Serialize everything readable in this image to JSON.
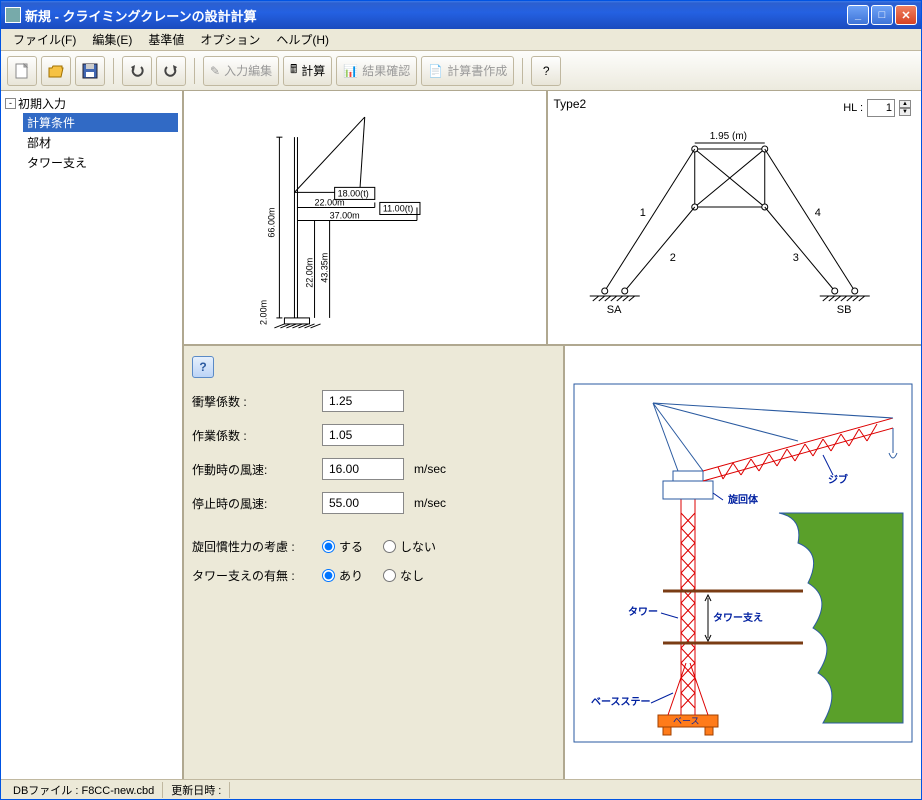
{
  "window": {
    "title": "新規 - クライミングクレーンの設計計算"
  },
  "menu": {
    "file": "ファイル(F)",
    "edit": "編集(E)",
    "base": "基準値",
    "option": "オプション",
    "help": "ヘルプ(H)"
  },
  "toolbar": {
    "input_edit": "入力編集",
    "calc": "計算",
    "result": "結果確認",
    "report": "計算書作成"
  },
  "tree": {
    "root": "初期入力",
    "children": [
      "計算条件",
      "部材",
      "タワー支え"
    ]
  },
  "diagram_left": {
    "load_top": "18.00(t)",
    "load_side": "11.00(t)",
    "d_22_top": "22.00m",
    "d_37": "37.00m",
    "h_66": "66.00m",
    "h_43": "43.35m",
    "h_22": "22.00m",
    "h_2": "2.00m"
  },
  "diagram_right": {
    "title": "Type2",
    "hl_label": "HL :",
    "hl_value": "1",
    "span": "1.95 (m)",
    "leg1": "1",
    "leg2": "2",
    "leg3": "3",
    "leg4": "4",
    "sa": "SA",
    "sb": "SB"
  },
  "form": {
    "impact_label": "衝撃係数 :",
    "impact": "1.25",
    "work_label": "作業係数 :",
    "work": "1.05",
    "wind_op_label": "作動時の風速:",
    "wind_op": "16.00",
    "wind_stop_label": "停止時の風速:",
    "wind_stop": "55.00",
    "wind_unit": "m/sec",
    "inertia_label": "旋回慣性力の考慮 :",
    "inertia_yes": "する",
    "inertia_no": "しない",
    "tower_sup_label": "タワー支えの有無 :",
    "tower_sup_yes": "あり",
    "tower_sup_no": "なし"
  },
  "crane_labels": {
    "jib": "ジブ",
    "swivel": "旋回体",
    "tower": "タワー",
    "tower_sup": "タワー支え",
    "base_stay": "ベースステー",
    "base": "ベース"
  },
  "status": {
    "db_label": "DBファイル :",
    "db_value": "F8CC-new.cbd",
    "update_label": "更新日時 :"
  }
}
